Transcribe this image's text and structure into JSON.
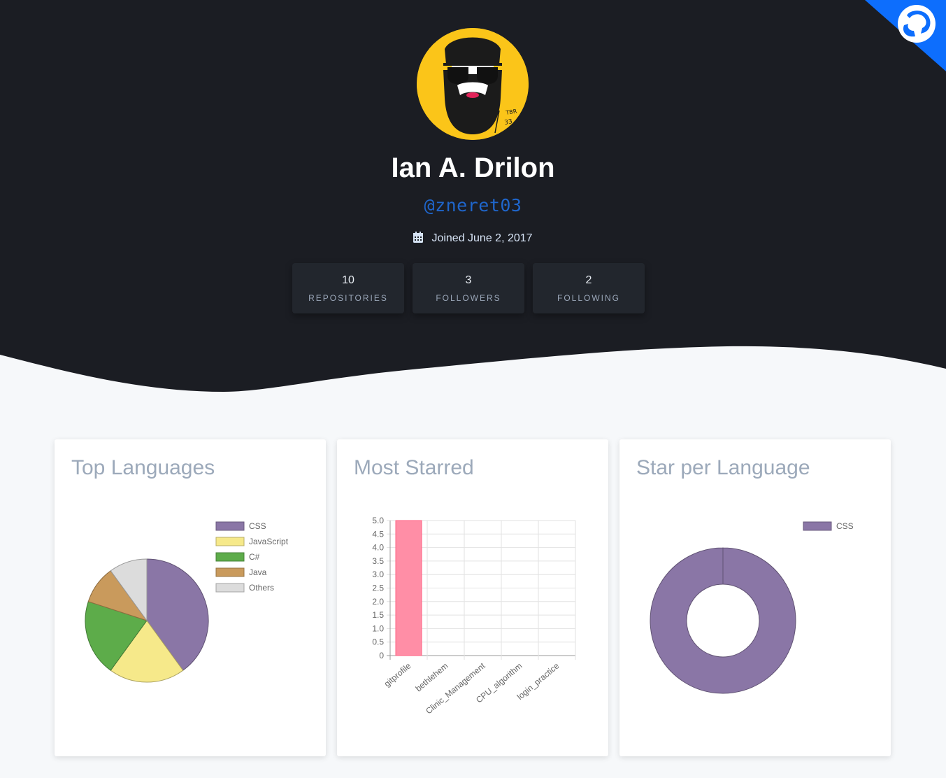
{
  "profile": {
    "name": "Ian A. Drilon",
    "username": "@zneret03",
    "joined": "Joined June 2, 2017"
  },
  "stats": [
    {
      "value": "10",
      "label": "REPOSITORIES"
    },
    {
      "value": "3",
      "label": "FOLLOWERS"
    },
    {
      "value": "2",
      "label": "FOLLOWING"
    }
  ],
  "colors": {
    "hero_bg": "#1b1d23",
    "page_bg": "#f6f8fa",
    "accent_blue": "#0d6efd",
    "username": "#1f66cc"
  },
  "icons": {
    "corner": "github-octocat-icon",
    "joined": "calendar-icon"
  },
  "cards": {
    "top_languages": {
      "title": "Top Languages"
    },
    "most_starred": {
      "title": "Most Starred"
    },
    "star_per_language": {
      "title": "Star per Language"
    }
  },
  "chart_data": [
    {
      "type": "pie",
      "title": "Top Languages",
      "legend_position": "right",
      "labels": [
        "CSS",
        "JavaScript",
        "C#",
        "Java",
        "Others"
      ],
      "values": [
        4,
        2,
        2,
        1,
        1
      ],
      "colors": [
        "#8a76a6",
        "#f6e98a",
        "#5dac4a",
        "#c99a5c",
        "#dcdcdc"
      ]
    },
    {
      "type": "bar",
      "title": "Most Starred",
      "categories": [
        "gitprofile",
        "bethlehem",
        "Clinic_Management",
        "CPU_algorithm",
        "login_practice"
      ],
      "values": [
        5,
        0,
        0,
        0,
        0
      ],
      "ylim": [
        0,
        5
      ],
      "yticks": [
        "0",
        "0.5",
        "1.0",
        "1.5",
        "2.0",
        "2.5",
        "3.0",
        "3.5",
        "4.0",
        "4.5",
        "5.0"
      ],
      "grid": true,
      "bar_color": "#ff8ea6"
    },
    {
      "type": "pie",
      "subtype": "doughnut",
      "title": "Star per Language",
      "legend_position": "top-right",
      "labels": [
        "CSS"
      ],
      "values": [
        5
      ],
      "colors": [
        "#8a76a6"
      ]
    }
  ]
}
